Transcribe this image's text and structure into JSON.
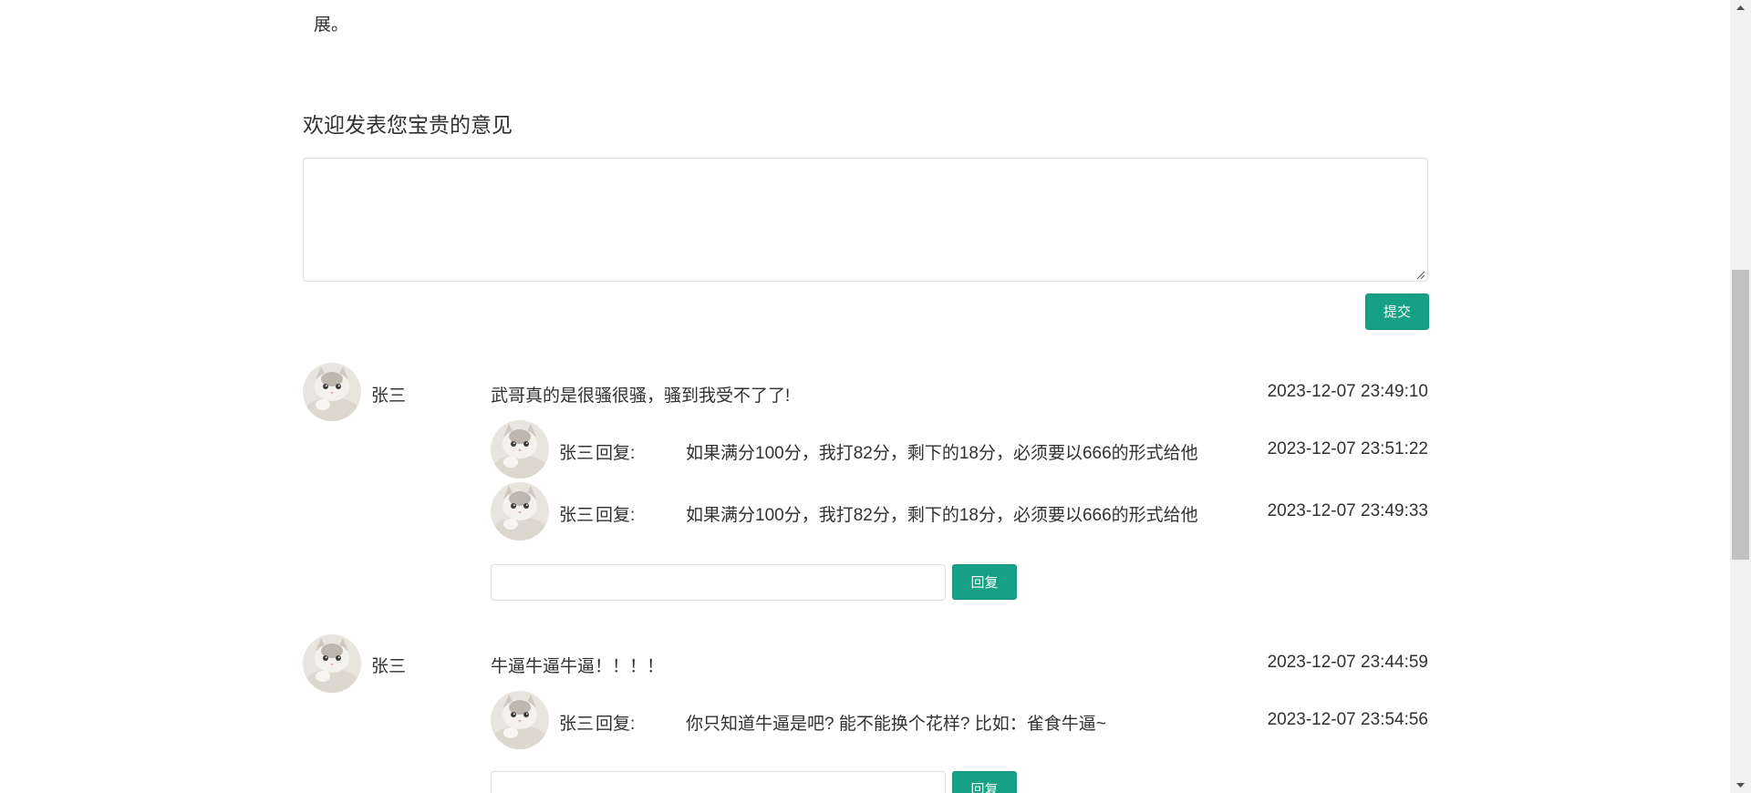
{
  "article_tail": "展。",
  "comment_section": {
    "title": "欢迎发表您宝贵的意见",
    "textarea_placeholder": "",
    "submit_label": "提交"
  },
  "comments": [
    {
      "user": "张三",
      "text": "武哥真的是很骚很骚，骚到我受不了了!",
      "time": "2023-12-07 23:49:10",
      "replies": [
        {
          "user": "张三",
          "label": "回复:",
          "text": "如果满分100分，我打82分，剩下的18分，必须要以666的形式给他",
          "time": "2023-12-07 23:51:22"
        },
        {
          "user": "张三",
          "label": "回复:",
          "text": "如果满分100分，我打82分，剩下的18分，必须要以666的形式给他",
          "time": "2023-12-07 23:49:33"
        }
      ],
      "reply_button": "回复"
    },
    {
      "user": "张三",
      "text": "牛逼牛逼牛逼！！！！",
      "time": "2023-12-07 23:44:59",
      "replies": [
        {
          "user": "张三",
          "label": "回复:",
          "text": "你只知道牛逼是吧? 能不能换个花样? 比如：雀食牛逼~",
          "time": "2023-12-07 23:54:56"
        }
      ],
      "reply_button": "回复"
    }
  ],
  "colors": {
    "accent": "#16a085",
    "text": "#303133",
    "border": "#dcdfe6"
  }
}
